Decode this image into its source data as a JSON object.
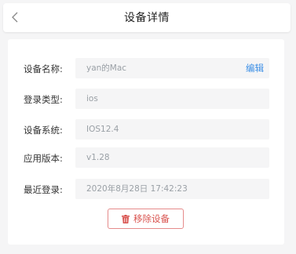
{
  "header": {
    "title": "设备详情"
  },
  "details": {
    "rows": [
      {
        "label": "设备名称:",
        "value": "yan的Mac",
        "action": "编辑"
      },
      {
        "label": "登录类型:",
        "value": "ios"
      },
      {
        "label": "设备系统:",
        "value": "IOS12.4"
      },
      {
        "label": "应用版本:",
        "value": "v1.28"
      },
      {
        "label": "最近登录:",
        "value": "2020年8月28日 17:42:23"
      }
    ]
  },
  "actions": {
    "remove_label": "移除设备"
  },
  "colors": {
    "accent_blue": "#3a8ee6",
    "danger_red": "#d9534f",
    "field_bg": "#f5f5f6"
  },
  "icons": {
    "back": "chevron-left-icon",
    "remove": "trash-icon"
  }
}
